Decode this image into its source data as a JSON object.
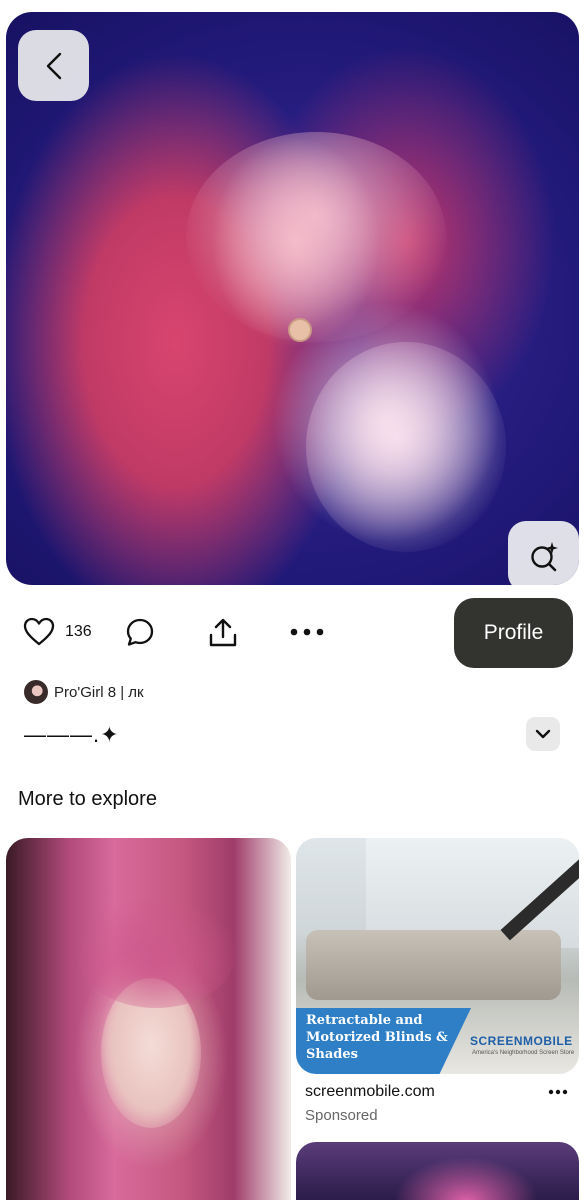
{
  "pin": {
    "like_count": "136",
    "profile_label": "Profile",
    "author": "Pro'Girl 8 | лк",
    "description": "———.✦"
  },
  "explore": {
    "title": "More to explore",
    "ad": {
      "headline": "Retractable and Motorized Blinds & Shades",
      "brand": "SCREENMOBILE",
      "tagline": "America's Neighborhood Screen Store",
      "domain": "screenmobile.com",
      "sponsored_label": "Sponsored"
    }
  },
  "icons": [
    "back-chevron-icon",
    "visual-search-icon",
    "heart-icon",
    "comment-icon",
    "share-icon",
    "more-icon",
    "chevron-down-icon"
  ]
}
